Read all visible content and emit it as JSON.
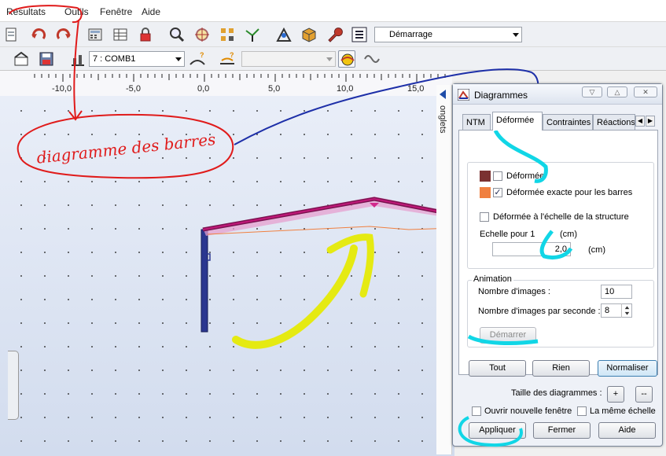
{
  "menu": [
    "Résultats",
    "Outils",
    "Fenêtre",
    "Aide"
  ],
  "toolbar": {
    "view_combo": "Démarrage",
    "load_case_combo": "7 : COMB1",
    "empty_combo": ""
  },
  "ruler": [
    "-10,0",
    "-5,0",
    "0,0",
    "5,0",
    "10,0",
    "15,0"
  ],
  "annotation": {
    "handwritten": "diagramme des barres"
  },
  "onglets_label": "onglets",
  "dialog": {
    "title": "Diagrammes",
    "tabs": [
      "NTM",
      "Déformée",
      "Contraintes",
      "Réactions"
    ],
    "active_tab": "Déformée",
    "deformee": {
      "deformee_label": "Déformée",
      "deformee_checked": false,
      "deformee_color": "#7b3131",
      "exacte_label": "Déformée exacte pour les barres",
      "exacte_checked": true,
      "exacte_color": "#f08040",
      "echelle_structure_label": "Déformée à l'échelle de la structure",
      "echelle_structure_checked": false,
      "echelle_pour_label": "Echelle pour 1",
      "echelle_pour_unit": "(cm)",
      "echelle_value": "2,0",
      "echelle_unit": "(cm)"
    },
    "animation": {
      "legend": "Animation",
      "nb_images_label": "Nombre d'images :",
      "nb_images_value": "10",
      "nb_images_sec_label": "Nombre d'images par seconde :",
      "nb_images_sec_value": "8",
      "start_button": "Démarrer"
    },
    "buttons": {
      "tout": "Tout",
      "rien": "Rien",
      "normaliser": "Normaliser"
    },
    "taille_label": "Taille des diagrammes :",
    "plus": "+",
    "minus": "--",
    "nouvelle_fenetre_label": "Ouvrir nouvelle fenêtre",
    "nouvelle_fenetre_checked": false,
    "meme_echelle_label": "La même échelle",
    "meme_echelle_checked": false,
    "footer": {
      "appliquer": "Appliquer",
      "fermer": "Fermer",
      "aide": "Aide"
    }
  },
  "colors": {
    "red_annotation": "#e01b1b",
    "blue_annotation": "#1d2fa8",
    "yellow_annotation": "#e5ea12",
    "cyan_annotation": "#11d6e6",
    "beam": "#c2187a",
    "column": "#2b3790"
  }
}
